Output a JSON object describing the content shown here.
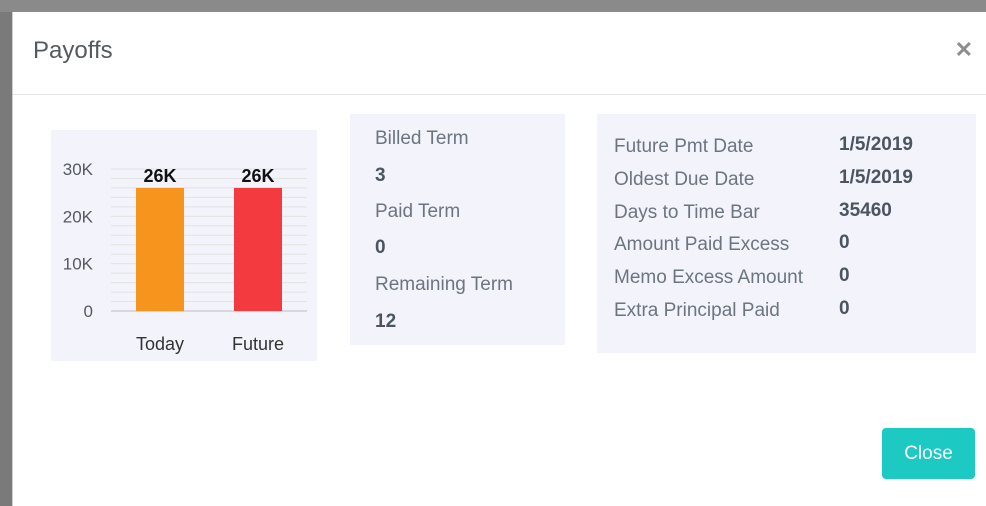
{
  "modal": {
    "title": "Payoffs",
    "close_icon": "close-icon",
    "close_label": "Close"
  },
  "terms": {
    "billed_term_label": "Billed Term",
    "billed_term_value": "3",
    "paid_term_label": "Paid Term",
    "paid_term_value": "0",
    "remaining_term_label": "Remaining Term",
    "remaining_term_value": "12"
  },
  "info": {
    "rows": [
      {
        "label": "Future Pmt Date",
        "value": "1/5/2019"
      },
      {
        "label": "Oldest Due Date",
        "value": "1/5/2019"
      },
      {
        "label": "Days to Time Bar",
        "value": "35460"
      },
      {
        "label": "Amount Paid Excess",
        "value": "0"
      },
      {
        "label": "Memo Excess Amount",
        "value": "0"
      },
      {
        "label": "Extra Principal Paid",
        "value": "0"
      }
    ]
  },
  "chart_data": {
    "type": "bar",
    "categories": [
      "Today",
      "Future"
    ],
    "values": [
      26000,
      26000
    ],
    "data_labels": [
      "26K",
      "26K"
    ],
    "colors": [
      "#f7941e",
      "#f23a3f"
    ],
    "y_ticks": [
      "0",
      "10K",
      "20K",
      "30K"
    ],
    "ylim": [
      0,
      30000
    ],
    "grid": true,
    "title": "",
    "xlabel": "",
    "ylabel": ""
  }
}
